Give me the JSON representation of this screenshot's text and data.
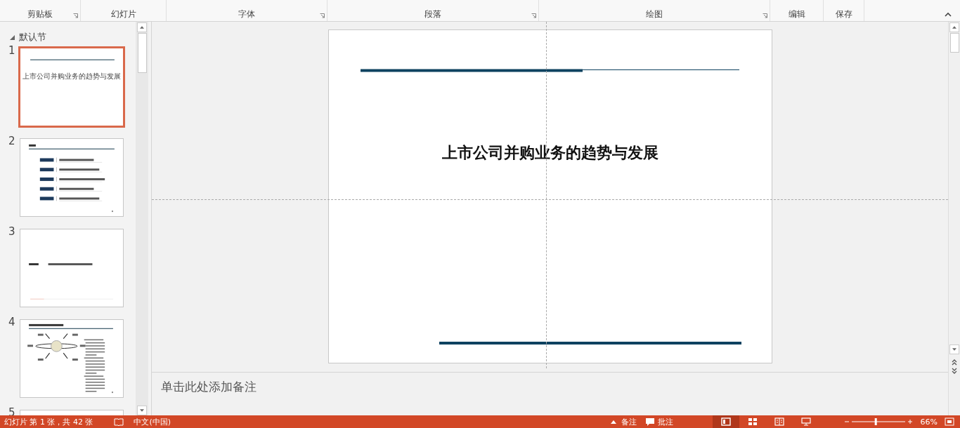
{
  "ribbon": {
    "groups": [
      {
        "label": "剪贴板",
        "launcher": true
      },
      {
        "label": "幻灯片",
        "launcher": false
      },
      {
        "label": "字体",
        "launcher": true
      },
      {
        "label": "段落",
        "launcher": true
      },
      {
        "label": "绘图",
        "launcher": true
      },
      {
        "label": "编辑",
        "launcher": false
      },
      {
        "label": "保存",
        "launcher": false
      }
    ]
  },
  "thumbnails_pane": {
    "section": {
      "name": "默认节",
      "expanded": true
    },
    "slides": [
      {
        "number": "1",
        "selected": true,
        "kind": "title",
        "title": "上市公司并购业务的趋势与发展"
      },
      {
        "number": "2",
        "selected": false,
        "kind": "contents"
      },
      {
        "number": "3",
        "selected": false,
        "kind": "section"
      },
      {
        "number": "4",
        "selected": false,
        "kind": "diagram"
      },
      {
        "number": "5",
        "selected": false,
        "kind": "blank"
      }
    ]
  },
  "slide": {
    "title": "上市公司并购业务的趋势与发展"
  },
  "notes": {
    "placeholder": "单击此处添加备注"
  },
  "status_bar": {
    "slide_info": "幻灯片 第 1 张，共 42 张",
    "language": "中文(中国)",
    "notes": "备注",
    "comments": "批注",
    "views": [
      {
        "kind": "normal",
        "selected": true
      },
      {
        "kind": "sorter",
        "selected": false
      },
      {
        "kind": "reading",
        "selected": false
      },
      {
        "kind": "show",
        "selected": false
      }
    ],
    "zoom_slider": {
      "level": 0.45
    },
    "zoom": "66%"
  }
}
